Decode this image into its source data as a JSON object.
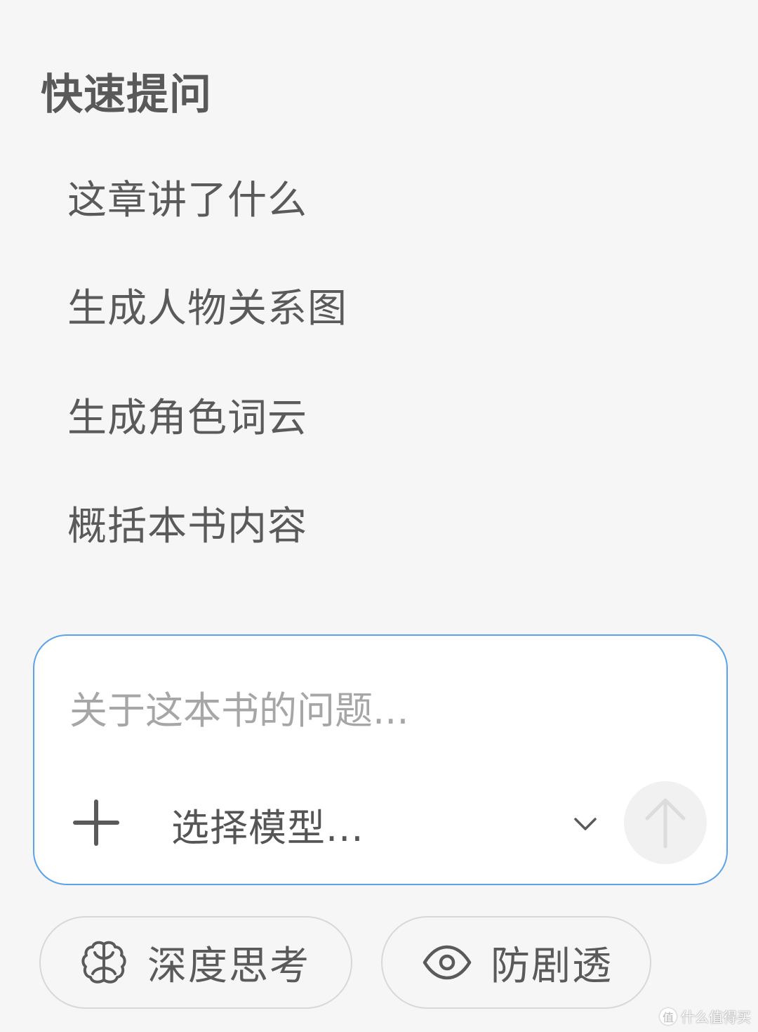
{
  "quick_ask": {
    "title": "快速提问",
    "items": [
      {
        "label": "这章讲了什么"
      },
      {
        "label": "生成人物关系图"
      },
      {
        "label": "生成角色词云"
      },
      {
        "label": "概括本书内容"
      }
    ]
  },
  "composer": {
    "placeholder": "关于这本书的问题...",
    "value": "",
    "model_select": {
      "selected_label": "选择模型..."
    },
    "icons": {
      "attach": "plus-icon",
      "dropdown": "chevron-down-icon",
      "send": "arrow-up-icon"
    }
  },
  "toggles": [
    {
      "label": "深度思考",
      "icon": "brain-icon"
    },
    {
      "label": "防剧透",
      "icon": "eye-icon"
    }
  ],
  "watermark": {
    "text": "什么值得买",
    "badge": "值"
  },
  "colors": {
    "background": "#f6f6f6",
    "composer_border": "#5aa2ea",
    "text": "#5a5a5a",
    "placeholder": "#a6a6a6",
    "send_button_bg": "#f1f1f1"
  }
}
